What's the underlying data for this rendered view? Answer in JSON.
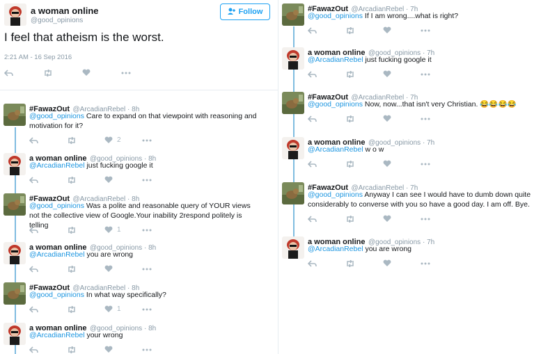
{
  "main_tweet": {
    "name": "a woman online",
    "handle": "@good_opinions",
    "follow_label": "Follow",
    "text": "I feel that atheism is the worst.",
    "timestamp": "2:21 AM - 16 Sep 2016"
  },
  "left_replies": [
    {
      "name": "#FawazOut",
      "meta": "@ArcadianRebel · 8h",
      "mention": "@good_opinions",
      "text": " Care to expand on that viewpoint with reasoning and motivation for it?",
      "like_count": "2",
      "avatar": "fawaz"
    },
    {
      "name": "a woman online",
      "meta": "@good_opinions · 8h",
      "mention": "@ArcadianRebel",
      "text": " just fucking google it",
      "like_count": "",
      "avatar": "woman"
    },
    {
      "name": "#FawazOut",
      "meta": "@ArcadianRebel · 8h",
      "mention": "@good_opinions",
      "text": " Was a polite and reasonable query of YOUR views not the collective view of Google.Your inability 2respond politely is telling",
      "like_count": "1",
      "avatar": "fawaz"
    },
    {
      "name": "a woman online",
      "meta": "@good_opinions · 8h",
      "mention": "@ArcadianRebel",
      "text": " you are wrong",
      "like_count": "",
      "avatar": "woman"
    },
    {
      "name": "#FawazOut",
      "meta": "@ArcadianRebel · 8h",
      "mention": "@good_opinions",
      "text": " In what way specifically?",
      "like_count": "1",
      "avatar": "fawaz"
    },
    {
      "name": "a woman online",
      "meta": "@good_opinions · 8h",
      "mention": "@ArcadianRebel",
      "text": " your wrong",
      "like_count": "",
      "avatar": "woman"
    }
  ],
  "right_replies": [
    {
      "name": "#FawazOut",
      "meta": "@ArcadianRebel · 7h",
      "mention": "@good_opinions",
      "text": " If I am wrong....what is right?",
      "avatar": "fawaz"
    },
    {
      "name": "a woman online",
      "meta": "@good_opinions · 7h",
      "mention": "@ArcadianRebel",
      "text": " just fucking google it",
      "avatar": "woman"
    },
    {
      "name": "#FawazOut",
      "meta": "@ArcadianRebel · 7h",
      "mention": "@good_opinions",
      "text": " Now, now...that isn't very Christian. 😂😂😂😂",
      "avatar": "fawaz"
    },
    {
      "name": "a woman online",
      "meta": "@good_opinions · 7h",
      "mention": "@ArcadianRebel",
      "text": " w o w",
      "avatar": "woman"
    },
    {
      "name": "#FawazOut",
      "meta": "@ArcadianRebel · 7h",
      "mention": "@good_opinions",
      "text": " Anyway I can see I would have to dumb down quite considerably to converse with you so have a good day. I am off. Bye.",
      "avatar": "fawaz"
    },
    {
      "name": "a woman online",
      "meta": "@good_opinions · 7h",
      "mention": "@ArcadianRebel",
      "text": " you are wrong",
      "avatar": "woman"
    }
  ],
  "icons": {
    "reply": "reply-icon",
    "retweet": "retweet-icon",
    "like": "heart-icon",
    "more": "more-icon"
  },
  "colors": {
    "mention": "#1b95e0",
    "thread_line": "#7fbce0",
    "action_icons": "#aab8c2",
    "follow": "#1da1f2"
  }
}
